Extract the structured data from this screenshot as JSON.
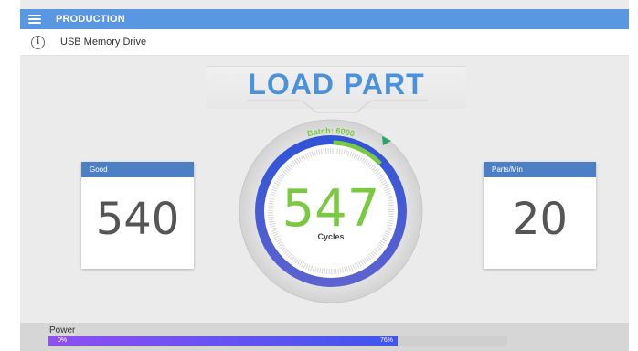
{
  "header": {
    "title": "PRODUCTION"
  },
  "info": {
    "device": "USB Memory Drive"
  },
  "banner": {
    "text": "LOAD PART"
  },
  "cards": {
    "good": {
      "label": "Good",
      "value": "540"
    },
    "parts_per_min": {
      "label": "Parts/Min",
      "value": "20"
    }
  },
  "gauge": {
    "batch_label": "Batch: 6000",
    "cycles_value": "547",
    "cycles_label": "Cycles",
    "progress_fraction": 0.09,
    "colors": {
      "ring": "#4a5ad4",
      "progress": "#7ac943",
      "value": "#7ac943"
    }
  },
  "power": {
    "label": "Power",
    "min_label": "0%",
    "value_label": "76%",
    "value": 0.76
  },
  "colors": {
    "accent": "#5a97e2",
    "card_header": "#4d7fc4",
    "banner": "#4a93dc"
  }
}
